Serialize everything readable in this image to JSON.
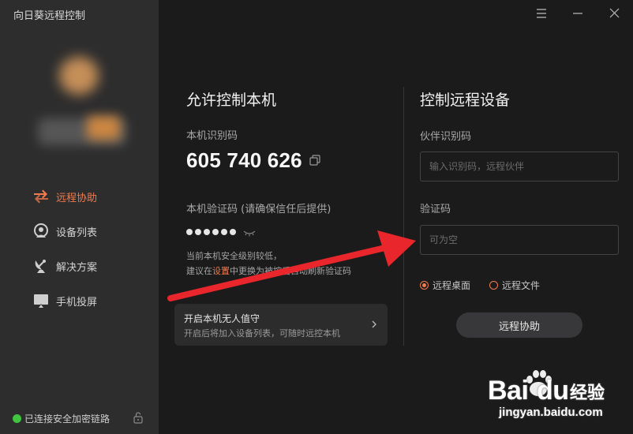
{
  "app": {
    "title": "向日葵远程控制"
  },
  "sidebar": {
    "items": [
      {
        "label": "远程协助",
        "icon": "remote-assist-icon",
        "active": true
      },
      {
        "label": "设备列表",
        "icon": "device-list-icon",
        "active": false
      },
      {
        "label": "解决方案",
        "icon": "satellite-dish-icon",
        "active": false
      },
      {
        "label": "手机投屏",
        "icon": "screen-cast-icon",
        "active": false
      }
    ],
    "status": "已连接安全加密链路"
  },
  "local": {
    "title": "允许控制本机",
    "id_label": "本机识别码",
    "id_value": "605 740 626",
    "code_label": "本机验证码 (请确保信任后提供)",
    "note_line1": "当前本机安全级别较低，",
    "note_prefix": "建议在",
    "note_link": "设置",
    "note_suffix": "中更换为被控后自动刷新验证码",
    "unattended_title": "开启本机无人值守",
    "unattended_sub": "开启后将加入设备列表，可随时远控本机"
  },
  "remote": {
    "title": "控制远程设备",
    "partner_label": "伙伴识别码",
    "partner_placeholder": "输入识别码，远程伙伴",
    "code_label": "验证码",
    "code_placeholder": "可为空",
    "radio_desktop": "远程桌面",
    "radio_file": "远程文件",
    "selected_mode": "远程桌面",
    "assist_button": "远程协助"
  },
  "watermark": {
    "brand": "Bai",
    "brand2": "du",
    "jingyan": "经验",
    "url": "jingyan.baidu.com"
  },
  "colors": {
    "accent": "#f27a4c",
    "sidebar_bg": "#2d2d2e",
    "main_bg": "#1b1b1c",
    "status_green": "#3fc53f",
    "arrow_red": "#e8262b"
  }
}
